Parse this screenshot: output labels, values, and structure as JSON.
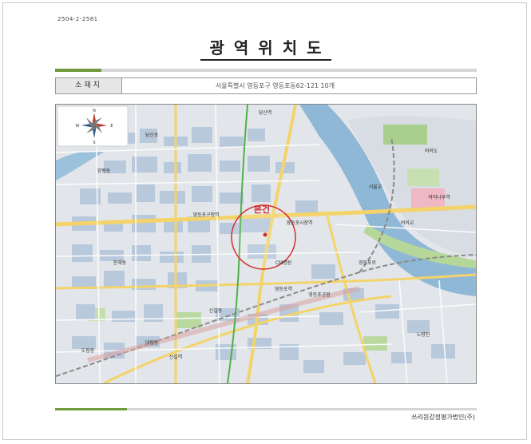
{
  "document": {
    "code": "2504-2-2581",
    "title": "광역위치도",
    "location_label": "소재지",
    "location_value": "서울특별시 영등포구 영등포동62-121 10개",
    "firm_name": "쓰리원감정평가법인(주)"
  },
  "map": {
    "subject_label": "본건",
    "compass": {
      "north": "N",
      "south": "S",
      "east": "E",
      "west": "W"
    },
    "place_labels": [
      "당산역",
      "영등포구청역",
      "영등포시장역",
      "영등포역",
      "신길역",
      "노량진",
      "여의도",
      "CM병원",
      "영등포공원",
      "여의나루역",
      "당산초",
      "양평동",
      "문래동",
      "대림동",
      "도림동",
      "신길동",
      "영등포로",
      "서울교",
      "여의교"
    ]
  }
}
